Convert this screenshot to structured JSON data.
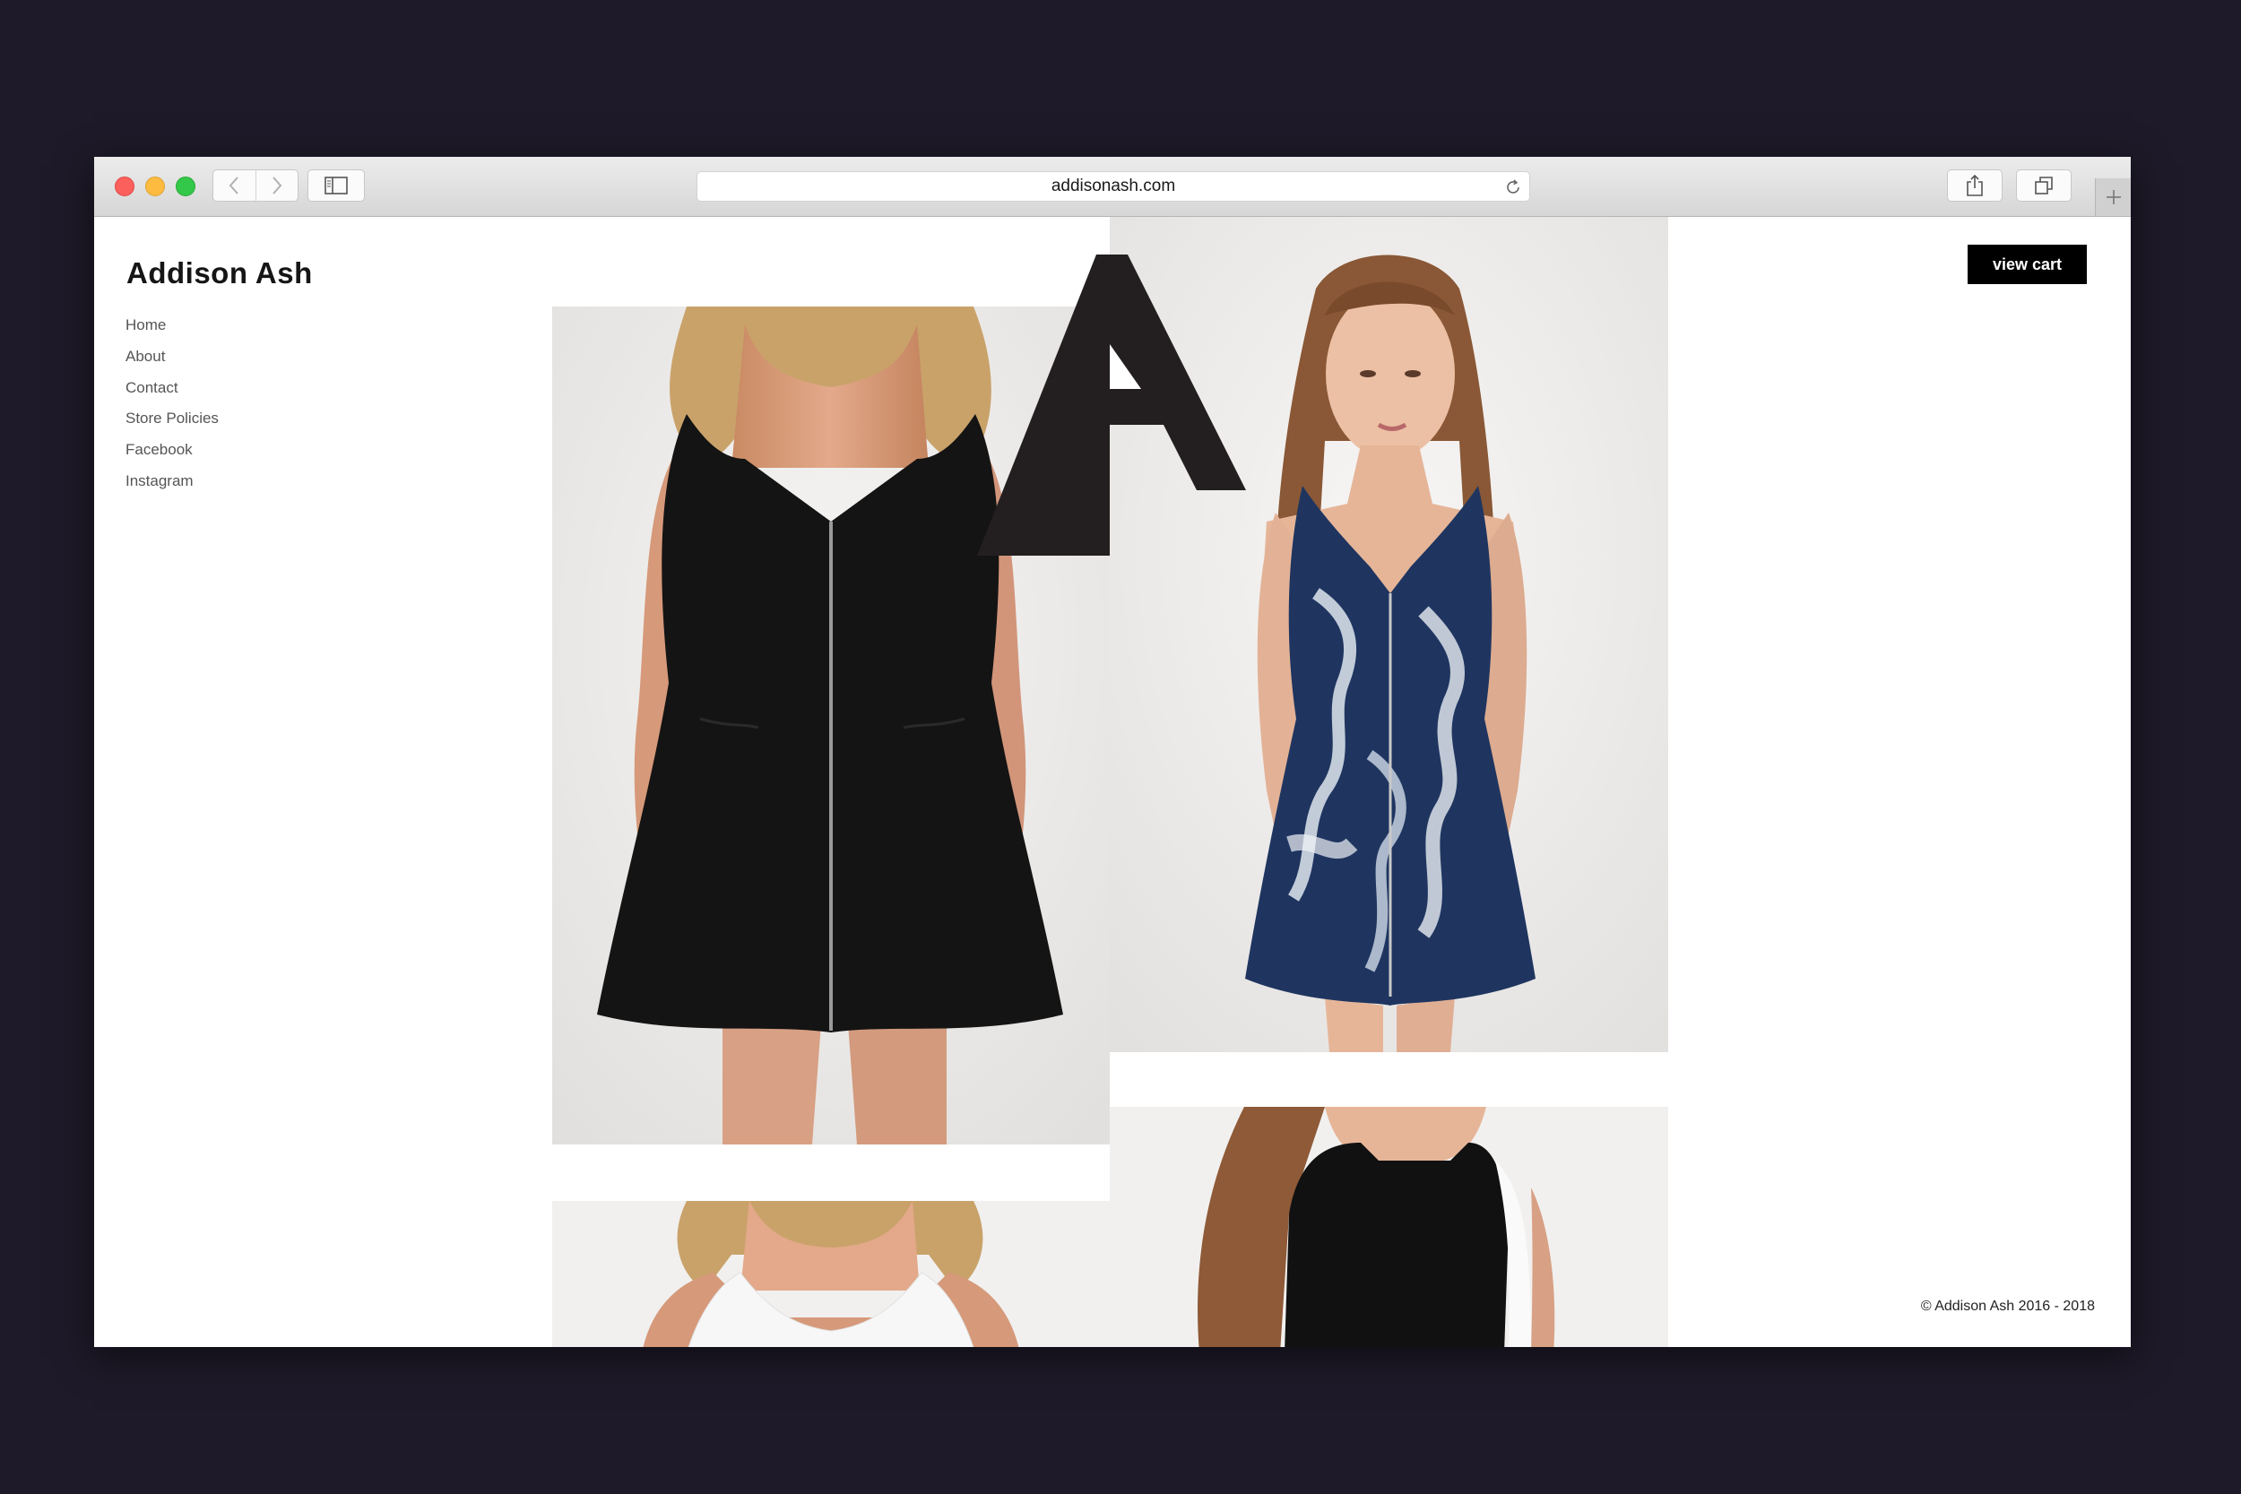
{
  "browser": {
    "url": "addisonash.com",
    "icons": {
      "back": "chevron-left-icon",
      "forward": "chevron-right-icon",
      "sidebar": "sidebar-icon",
      "reload": "reload-icon",
      "share": "share-icon",
      "tabs": "tabs-overview-icon",
      "new_tab": "plus-icon"
    }
  },
  "site": {
    "brand": "Addison Ash",
    "nav": [
      "Home",
      "About",
      "Contact",
      "Store Policies",
      "Facebook",
      "Instagram"
    ],
    "cart_label": "view cart",
    "copyright": "© Addison Ash 2016 - 2018",
    "logo_icon": "brand-a-logo-icon"
  },
  "gallery": {
    "images": [
      {
        "subject": "black zip-front sleeveless dress"
      },
      {
        "subject": "blue and white tie-dye zip-front dress"
      },
      {
        "subject": "white sleeveless top"
      },
      {
        "subject": "black dress with white side panel"
      }
    ]
  },
  "colors": {
    "desktop_bg": "#1e1a29",
    "cart_bg": "#000000",
    "cart_text": "#ffffff",
    "text": "#151515"
  }
}
